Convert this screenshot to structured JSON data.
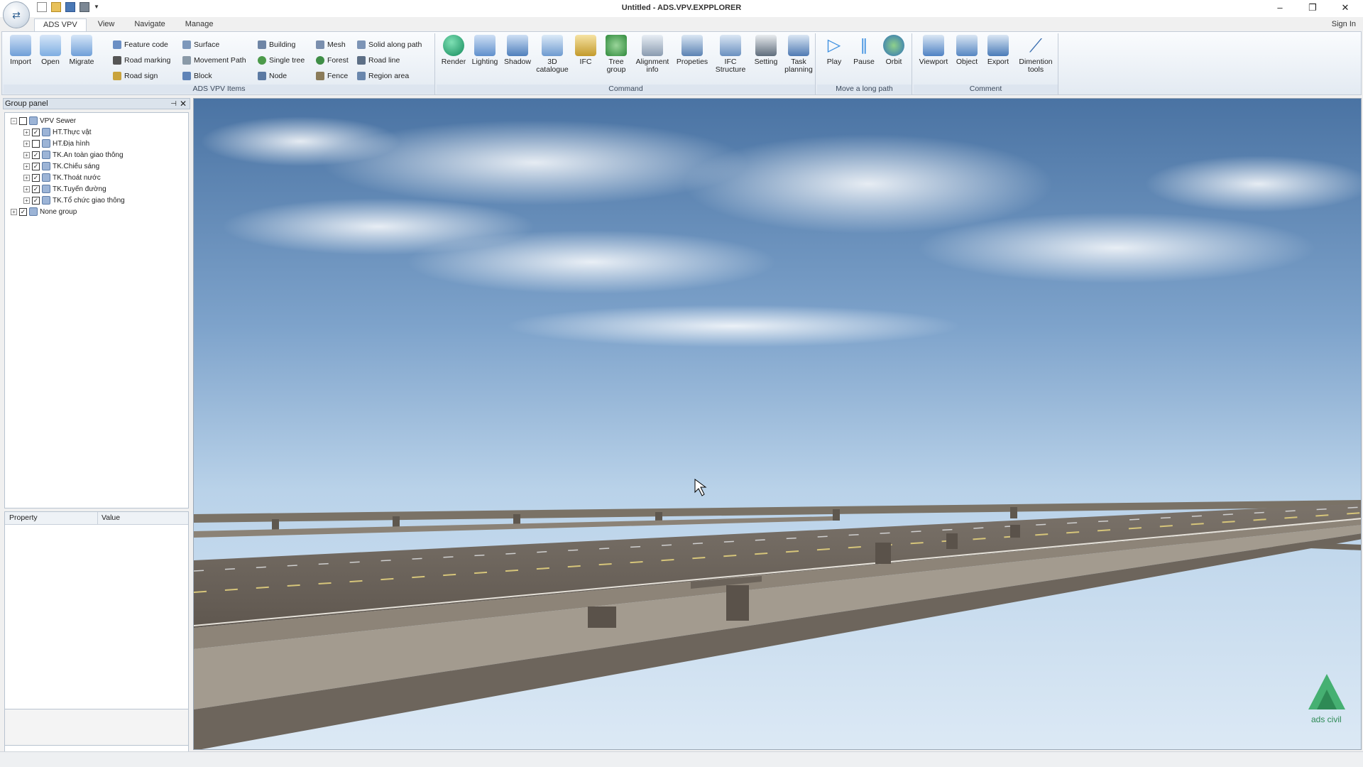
{
  "window": {
    "title": "Untitled - ADS.VPV.EXPPLORER",
    "minimize": "–",
    "restore": "❐",
    "close": "✕"
  },
  "quick_access": [
    "new-icon",
    "open-icon",
    "save-icon",
    "print-icon"
  ],
  "tabs": [
    "ADS VPV",
    "View",
    "Navigate",
    "Manage"
  ],
  "sign_in": "Sign In",
  "ribbon": {
    "groups": {
      "ads_items": "ADS VPV Items",
      "command": "Command",
      "move_path": "Move a long path",
      "comment": "Comment"
    },
    "file_buttons": [
      "Import",
      "Open",
      "Migrate"
    ],
    "items_col1": [
      "Feature code",
      "Road marking",
      "Road sign"
    ],
    "items_col2": [
      "Surface",
      "Movement Path",
      "Block"
    ],
    "items_col3": [
      "Building",
      "Single tree",
      "Node"
    ],
    "items_col4": [
      "Mesh",
      "Forest",
      "Fence"
    ],
    "items_col5": [
      "Solid along path",
      "Road line",
      "Region area"
    ],
    "command_buttons": [
      {
        "l1": "Render",
        "l2": ""
      },
      {
        "l1": "Lighting",
        "l2": ""
      },
      {
        "l1": "Shadow",
        "l2": ""
      },
      {
        "l1": "3D",
        "l2": "catalogue"
      },
      {
        "l1": "IFC",
        "l2": ""
      },
      {
        "l1": "Tree",
        "l2": "group"
      },
      {
        "l1": "Alignment",
        "l2": "info"
      },
      {
        "l1": "Propeties",
        "l2": ""
      },
      {
        "l1": "IFC",
        "l2": "Structure"
      },
      {
        "l1": "Setting",
        "l2": ""
      },
      {
        "l1": "Task",
        "l2": "planning"
      }
    ],
    "move_buttons": [
      "Play",
      "Pause",
      "Orbit"
    ],
    "comment_buttons": [
      {
        "l1": "Viewport",
        "l2": ""
      },
      {
        "l1": "Object",
        "l2": ""
      },
      {
        "l1": "Export",
        "l2": ""
      },
      {
        "l1": "Dimention",
        "l2": "tools"
      }
    ]
  },
  "group_panel": {
    "title": "Group panel",
    "pin": "⊣",
    "close": "✕",
    "tree": {
      "root": "VPV Sewer",
      "children": [
        "HT.Thực vật",
        "HT.Địa hình",
        "TK.An toàn giao thông",
        "TK.Chiếu sáng",
        "TK.Thoát nước",
        "TK.Tuyến đường",
        "TK.Tổ chức giao thông"
      ],
      "other": "None group"
    }
  },
  "property_grid": {
    "col_property": "Property",
    "col_value": "Value"
  },
  "logo_text": "ads civil",
  "colors": {
    "ribbon_bg": "#e3eaf2",
    "sky_top": "#4f79a8",
    "sky_bottom": "#d7e6f4",
    "road": "#6e665d",
    "logo": "#3aa36a"
  }
}
